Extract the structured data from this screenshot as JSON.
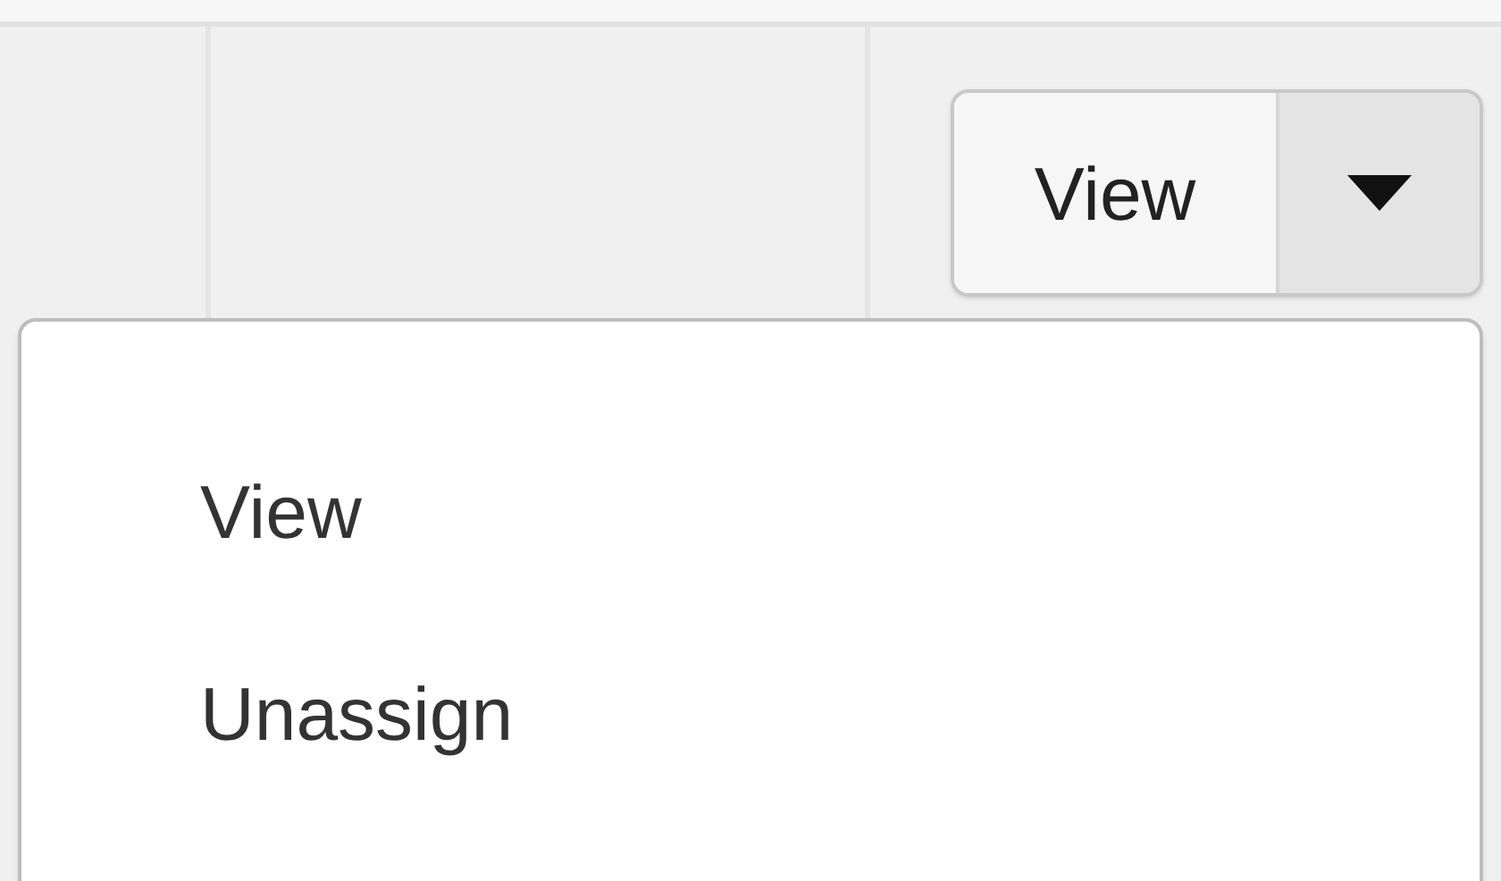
{
  "split_button": {
    "label": "View",
    "expanded": true
  },
  "menu": {
    "items": [
      {
        "label": "View"
      },
      {
        "label": "Unassign"
      }
    ]
  }
}
